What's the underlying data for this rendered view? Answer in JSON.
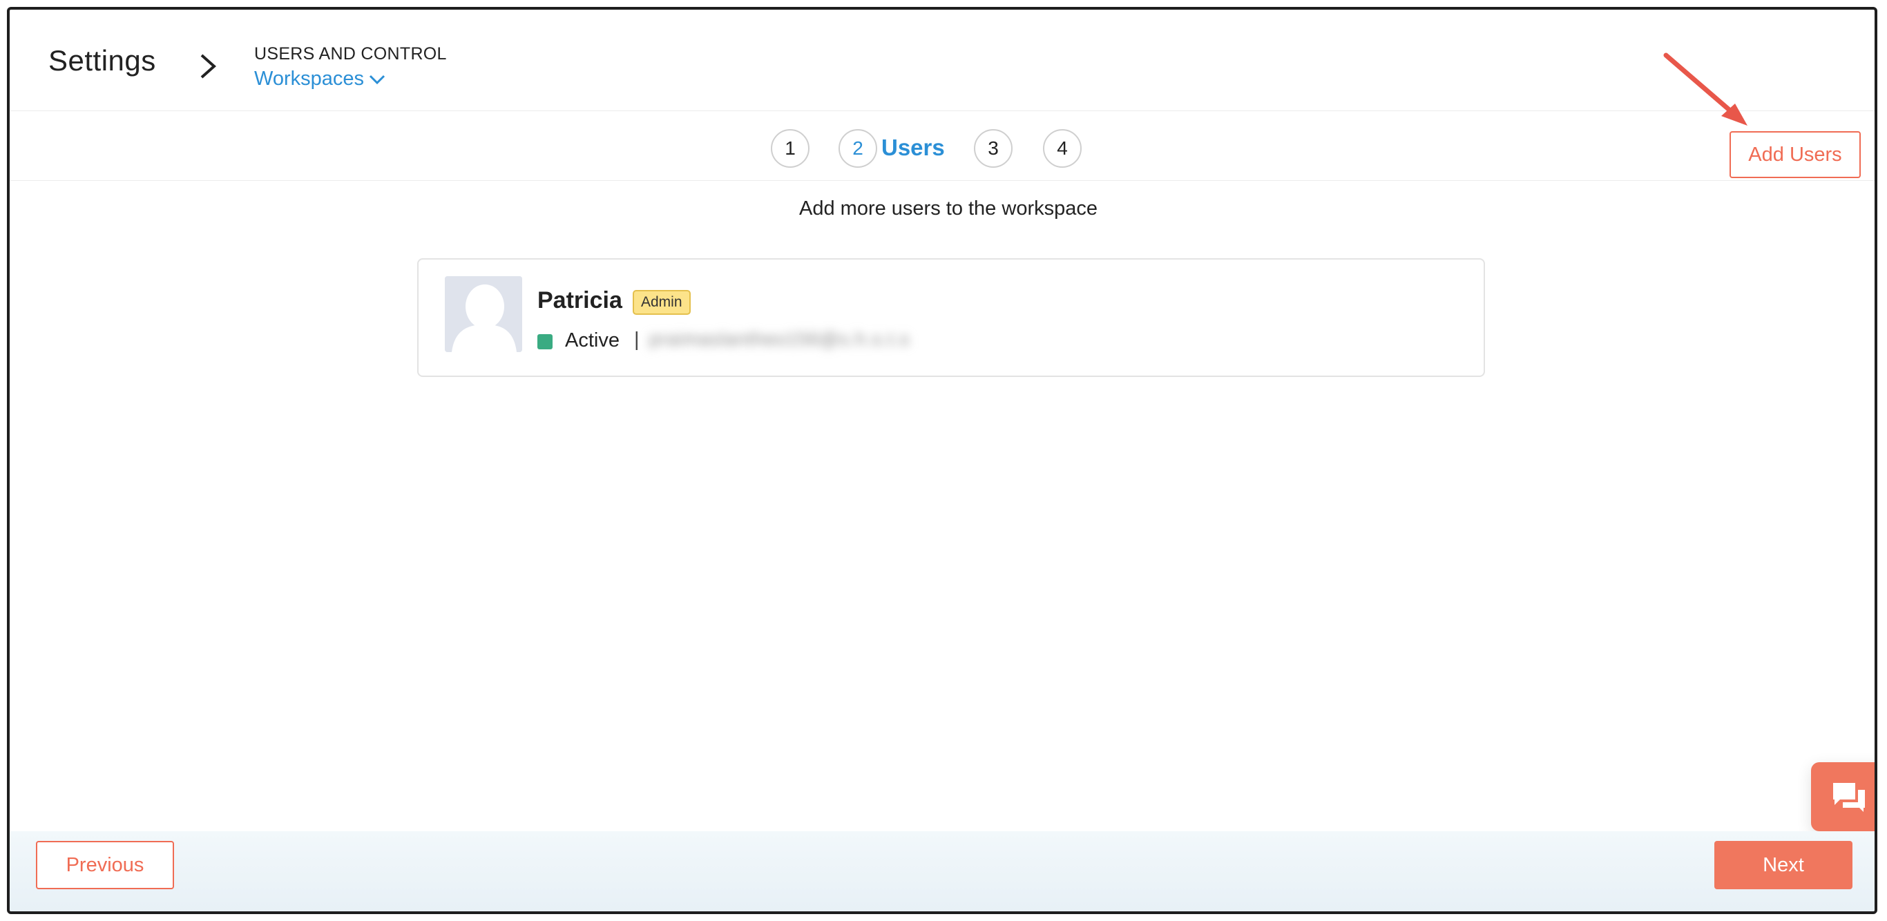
{
  "header": {
    "title": "Settings",
    "section": "USERS AND CONTROL",
    "current": "Workspaces"
  },
  "stepper": {
    "steps": [
      "1",
      "2",
      "3",
      "4"
    ],
    "active_label": "Users"
  },
  "actions": {
    "add_users_label": "Add Users"
  },
  "main": {
    "subtitle": "Add more users to the workspace",
    "users": [
      {
        "name": "Patricia",
        "role": "Admin",
        "status": "Active",
        "separator": "|",
        "email_obscured": "praimaslantheo156@s.h.s.t.s"
      }
    ]
  },
  "footer": {
    "previous_label": "Previous",
    "next_label": "Next"
  },
  "colors": {
    "accent": "#f06c54",
    "link": "#2b8fd6",
    "status_active": "#3aab82",
    "badge_bg": "#fce38a"
  },
  "icons": {
    "breadcrumb": "chevron-right-icon",
    "dropdown": "chevron-down-icon",
    "chat": "chat-bubbles-icon",
    "avatar": "user-silhouette-icon"
  }
}
